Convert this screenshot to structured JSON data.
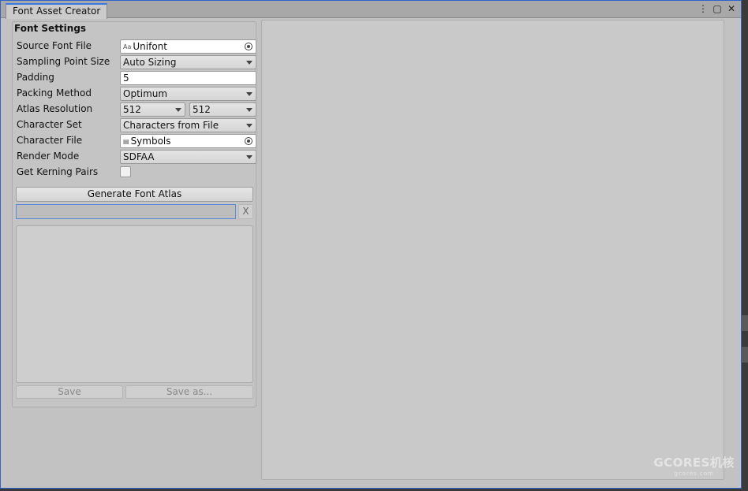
{
  "window": {
    "tab_title": "Font Asset Creator",
    "menu_icon": "kebab-menu-icon",
    "maximize_icon": "maximize-icon",
    "close_icon": "close-icon"
  },
  "settings": {
    "section_title": "Font Settings",
    "source_font_file": {
      "label": "Source Font File",
      "value": "Unifont",
      "icon": "font-asset-icon"
    },
    "sampling_point_size": {
      "label": "Sampling Point Size",
      "value": "Auto Sizing"
    },
    "padding": {
      "label": "Padding",
      "value": "5"
    },
    "packing_method": {
      "label": "Packing Method",
      "value": "Optimum"
    },
    "atlas_resolution": {
      "label": "Atlas Resolution",
      "width": "512",
      "height": "512"
    },
    "character_set": {
      "label": "Character Set",
      "value": "Characters from File"
    },
    "character_file": {
      "label": "Character File",
      "value": "Symbols",
      "icon": "text-file-icon"
    },
    "render_mode": {
      "label": "Render Mode",
      "value": "SDFAA"
    },
    "get_kerning_pairs": {
      "label": "Get Kerning Pairs",
      "checked": false
    }
  },
  "actions": {
    "generate_label": "Generate Font Atlas",
    "clear_label": "X",
    "progress": 0,
    "save_label": "Save",
    "save_as_label": "Save as..."
  },
  "watermark": {
    "brand": "GCORES机核",
    "url": "gcores.com"
  },
  "colors": {
    "accent": "#2e63c8",
    "window_bg": "#c2c2c2",
    "preview_bg": "#c9c9c9"
  }
}
